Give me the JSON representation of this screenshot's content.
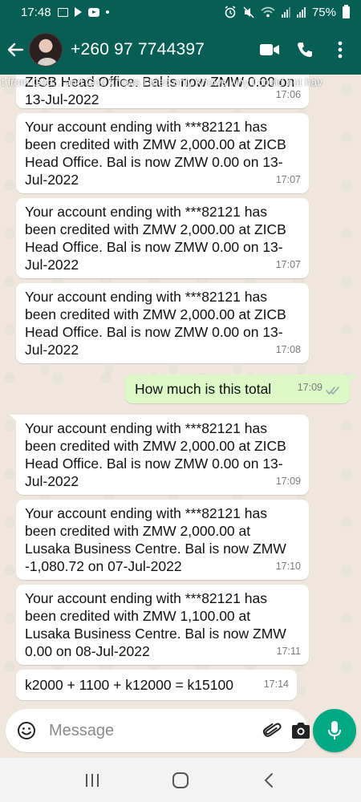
{
  "status_bar": {
    "time": "17:48",
    "battery": "75%"
  },
  "header": {
    "contact": "+260 97 7744397"
  },
  "status_caption": "t from God... and God knows I tried only knows why I could not hav",
  "messages": [
    {
      "direction": "in",
      "text": "ZICB Head Office. Bal is now ZMW 0.00 on 13-Jul-2022",
      "time": "17:06"
    },
    {
      "direction": "in",
      "text": "Your account ending with ***82121 has been credited with ZMW 2,000.00 at ZICB Head Office. Bal is now ZMW 0.00 on 13-Jul-2022",
      "time": "17:07"
    },
    {
      "direction": "in",
      "text": "Your account ending with ***82121 has been credited with ZMW 2,000.00 at ZICB Head Office. Bal is now ZMW 0.00 on 13-Jul-2022",
      "time": "17:07"
    },
    {
      "direction": "in",
      "text": "Your account ending with ***82121 has been credited with ZMW 2,000.00 at ZICB Head Office. Bal is now ZMW 0.00 on 13-Jul-2022",
      "time": "17:08"
    },
    {
      "direction": "out",
      "text": "How much is this total",
      "time": "17:09"
    },
    {
      "direction": "in",
      "text": "Your account ending with ***82121 has been credited with ZMW 2,000.00 at ZICB Head Office. Bal is now ZMW 0.00 on 13-Jul-2022",
      "time": "17:09"
    },
    {
      "direction": "in",
      "text": "Your account ending with ***82121 has been credited with ZMW 2,000.00 at Lusaka Business Centre. Bal is now ZMW -1,080.72 on 07-Jul-2022",
      "time": "17:10"
    },
    {
      "direction": "in",
      "text": "Your account ending with ***82121 has been credited with ZMW 1,100.00 at Lusaka Business Centre. Bal is now ZMW 0.00 on 08-Jul-2022",
      "time": "17:11"
    },
    {
      "direction": "in",
      "text": "k2000 + 1100 + k12000 = k15100",
      "time": "17:14"
    }
  ],
  "composer": {
    "placeholder": "Message"
  },
  "colors": {
    "header": "#075e54",
    "outgoing_bubble": "#dcf8c6",
    "incoming_bubble": "#ffffff",
    "mic_button": "#00a884",
    "chat_background": "#efe7dd"
  },
  "icons": {
    "header": [
      "back-arrow-icon",
      "avatar",
      "video-call-icon",
      "phone-icon",
      "more-vert-icon"
    ],
    "composer": [
      "emoji-icon",
      "attach-icon",
      "camera-icon",
      "mic-icon"
    ],
    "nav": [
      "recents-icon",
      "home-icon",
      "back-icon"
    ]
  }
}
